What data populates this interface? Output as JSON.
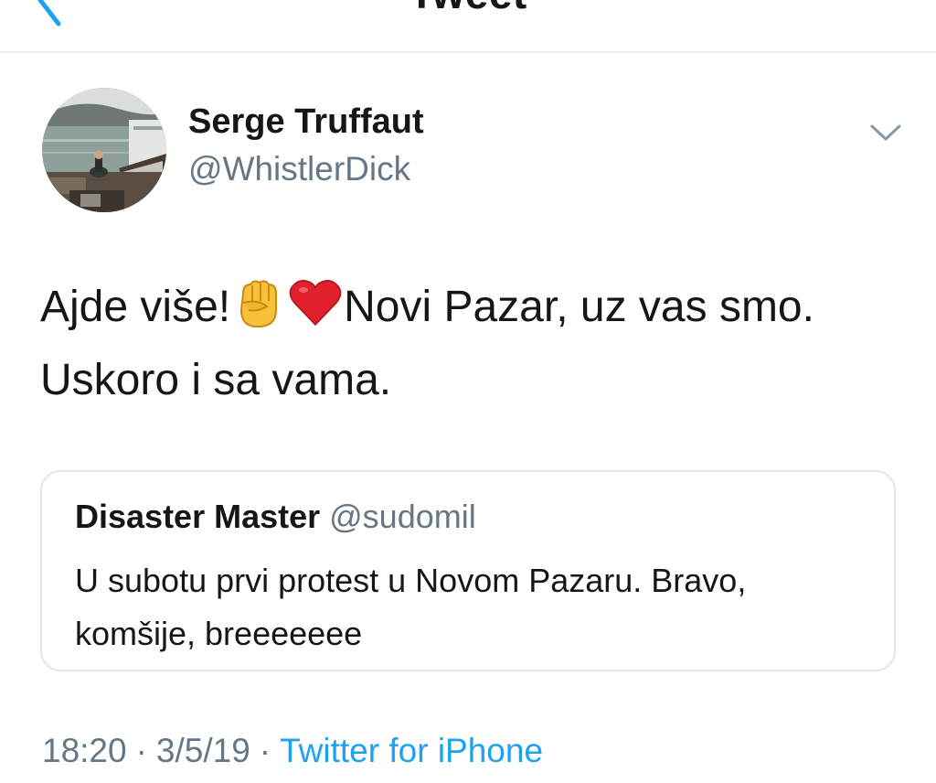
{
  "header": {
    "title": "Tweet",
    "back_icon": "chevron-left-icon"
  },
  "author": {
    "name": "Serge Truffaut",
    "handle": "@WhistlerDick",
    "caret_icon": "chevron-down-icon"
  },
  "tweet": {
    "line1_before": "Ajde više!",
    "emoji1": "raised-fist-emoji",
    "emoji2": "red-heart-emoji",
    "line1_after": "Novi Pazar, uz vas smo.",
    "line2": "Uskoro i sa vama."
  },
  "quoted_tweet": {
    "name": "Disaster Master",
    "handle": "@sudomil",
    "text": "U subotu prvi protest u Novom Pazaru. Bravo, komšije, breeeeeee"
  },
  "meta": {
    "time": "18:20",
    "separator": "·",
    "date": "3/5/19",
    "source": "Twitter for iPhone"
  },
  "colors": {
    "accent": "#1da1f2",
    "text_primary": "#14171a",
    "text_secondary": "#657786",
    "border": "#e1e8ed"
  }
}
